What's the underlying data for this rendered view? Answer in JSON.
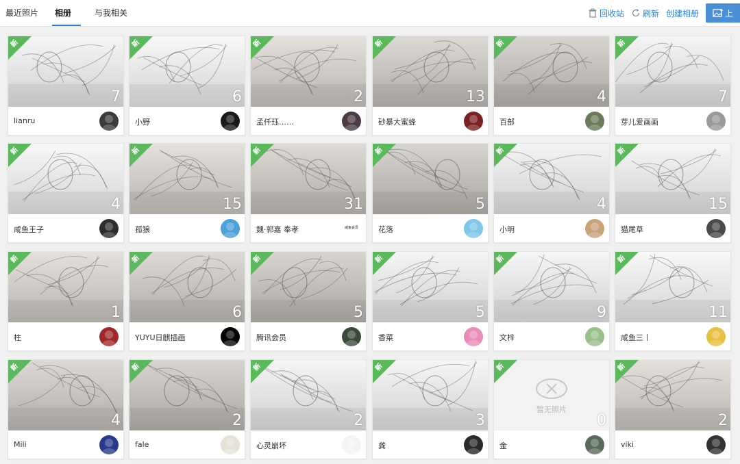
{
  "tabs": [
    {
      "label": "最近照片"
    },
    {
      "label": "相册"
    },
    {
      "label": "与我相关"
    }
  ],
  "actions": {
    "recycle": "回收站",
    "refresh": "刷新",
    "create": "创建相册",
    "upload": "上"
  },
  "badge_label": "新",
  "albums": [
    {
      "count": "7",
      "owner": "lianru",
      "avatar_color": "#3b3b3b"
    },
    {
      "count": "6",
      "owner": "小野",
      "avatar_color": "#1a1a1a"
    },
    {
      "count": "2",
      "owner": "孟仟珏……",
      "avatar_color": "#4a3b44"
    },
    {
      "count": "13",
      "owner": "砂暴大蜜蜂",
      "avatar_color": "#7a2222"
    },
    {
      "count": "4",
      "owner": "百部",
      "avatar_color": "#6b7b5a"
    },
    {
      "count": "7",
      "owner": "芽儿爱画画",
      "avatar_color": "#9a9a9a"
    },
    {
      "count": "4",
      "owner": "咸鱼王子",
      "avatar_color": "#2e2e2e"
    },
    {
      "count": "15",
      "owner": "孤狼",
      "avatar_color": "#4aa0d8"
    },
    {
      "count": "31",
      "owner": "魏·郭嘉 奉孝",
      "avatar_color": "#ffffff",
      "avatar_text": "咸鱼会员"
    },
    {
      "count": "5",
      "owner": "花落",
      "avatar_color": "#7fc6e8"
    },
    {
      "count": "4",
      "owner": "小明",
      "avatar_color": "#c9a27a"
    },
    {
      "count": "15",
      "owner": "猫尾草",
      "avatar_color": "#4a4a4a"
    },
    {
      "count": "1",
      "owner": "柱",
      "avatar_color": "#a02828"
    },
    {
      "count": "6",
      "owner": "YUYU日麒插画",
      "avatar_color": "#050505"
    },
    {
      "count": "5",
      "owner": "腾讯会员",
      "avatar_color": "#3a4a3a"
    },
    {
      "count": "5",
      "owner": "香菜",
      "avatar_color": "#e88cb8"
    },
    {
      "count": "9",
      "owner": "文梓",
      "avatar_color": "#9ac08a"
    },
    {
      "count": "11",
      "owner": "咸鱼三丨",
      "avatar_color": "#e8c040"
    },
    {
      "count": "4",
      "owner": "Mili",
      "avatar_color": "#2a3a8a"
    },
    {
      "count": "2",
      "owner": "fale",
      "avatar_color": "#e6e2d6"
    },
    {
      "count": "2",
      "owner": "心灵崩坏",
      "avatar_color": "#f4f4f4"
    },
    {
      "count": "3",
      "owner": "龚",
      "avatar_color": "#2a2a2a"
    },
    {
      "count": "0",
      "owner": "金",
      "avatar_color": "#5a6a5a",
      "empty": "暂无照片"
    },
    {
      "count": "2",
      "owner": "viki",
      "avatar_color": "#333333"
    }
  ]
}
